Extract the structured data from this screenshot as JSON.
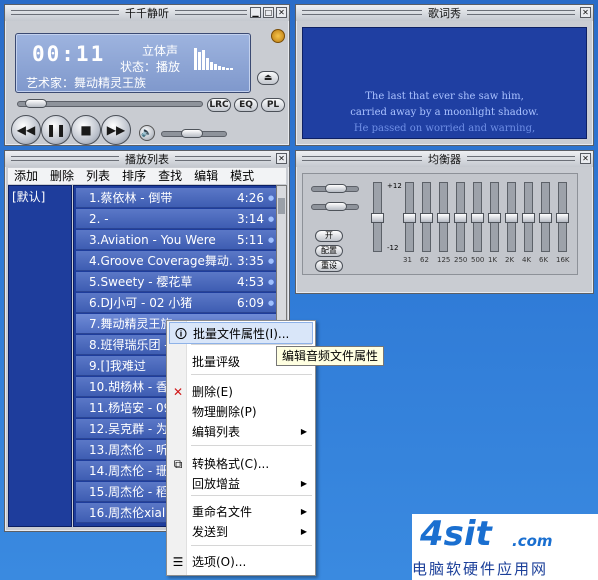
{
  "player": {
    "title": "千千静听",
    "time": "00:11",
    "mode": "立体声",
    "status": "状态：播放",
    "artist": "艺术家：舞动精灵王族",
    "buttons": {
      "lrc": "LRC",
      "eq": "EQ",
      "pl": "PL"
    },
    "progress": 0.05,
    "volume": 0.45
  },
  "lyrics": {
    "title": "歌词秀",
    "lines": [
      "The last that ever she saw him,",
      "carried away by a moonlight shadow.",
      "He passed on worried and warning,"
    ]
  },
  "playlist": {
    "title": "播放列表",
    "menu": [
      "添加",
      "删除",
      "列表",
      "排序",
      "查找",
      "编辑",
      "模式"
    ],
    "default_list": "[默认]",
    "rows": [
      {
        "title": "1.蔡依林 - 倒带",
        "dur": "4:26"
      },
      {
        "title": "2.  -",
        "dur": "3:14"
      },
      {
        "title": "3.Aviation - You Were",
        "dur": "5:11"
      },
      {
        "title": "4.Groove Coverage舞动…",
        "dur": "3:35"
      },
      {
        "title": "5.Sweety - 樱花草",
        "dur": "4:53"
      },
      {
        "title": "6.DJ小可 - 02 小猪",
        "dur": "6:09"
      },
      {
        "title": "7.舞动精灵王族",
        "dur": ""
      },
      {
        "title": "8.班得瑞乐团 -",
        "dur": ""
      },
      {
        "title": "9.[]我难过",
        "dur": ""
      },
      {
        "title": "10.胡杨林 - 香水",
        "dur": ""
      },
      {
        "title": "11.杨培安 - 09.",
        "dur": ""
      },
      {
        "title": "12.吴克群 - 为你",
        "dur": ""
      },
      {
        "title": "13.周杰伦 - 听妈",
        "dur": ""
      },
      {
        "title": "14.周杰伦 - 珊瑚",
        "dur": ""
      },
      {
        "title": "15.周杰伦 - 稻香",
        "dur": ""
      },
      {
        "title": "16.周杰伦xialala",
        "dur": ""
      }
    ]
  },
  "equalizer": {
    "title": "均衡器",
    "plus": "+12",
    "minus": "-12",
    "buttons": [
      "开",
      "配置",
      "重设"
    ],
    "bands": [
      "31",
      "62",
      "125",
      "250",
      "500",
      "1K",
      "2K",
      "4K",
      "6K",
      "16K"
    ]
  },
  "context_menu": {
    "items": [
      {
        "label": "批量文件属性(I)...",
        "arrow": false
      },
      {
        "label": "批量评级",
        "arrow": false
      },
      {
        "label": "删除(E)",
        "arrow": false
      },
      {
        "label": "物理删除(P)",
        "arrow": false
      },
      {
        "label": "编辑列表",
        "arrow": true
      },
      {
        "label": "转换格式(C)...",
        "arrow": false
      },
      {
        "label": "回放增益",
        "arrow": true
      },
      {
        "label": "重命名文件",
        "arrow": true
      },
      {
        "label": "发送到",
        "arrow": true
      },
      {
        "label": "选项(O)...",
        "arrow": false
      }
    ],
    "tooltip": "编辑音频文件属性"
  },
  "watermark": {
    "logo": "4sit",
    "domain": ".com",
    "subtitle": "电脑软硬件应用网"
  }
}
